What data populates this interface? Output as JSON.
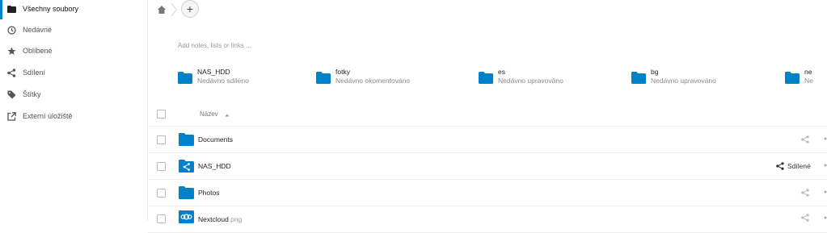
{
  "sidebar": {
    "items": [
      {
        "label": "Všechny soubory",
        "icon": "folder-icon",
        "active": true
      },
      {
        "label": "Nedávné",
        "icon": "clock-icon"
      },
      {
        "label": "Oblíbené",
        "icon": "star-icon"
      },
      {
        "label": "Sdílení",
        "icon": "share-icon"
      },
      {
        "label": "Štítky",
        "icon": "tag-icon"
      },
      {
        "label": "Externí úložiště",
        "icon": "external-icon"
      }
    ]
  },
  "notes": {
    "placeholder": "Add notes, lists or links ..."
  },
  "recommendations": [
    {
      "name": "NAS_HDD",
      "sub": "Nedávno sdíleno"
    },
    {
      "name": "fotky",
      "sub": "Nedávno okomentováno"
    },
    {
      "name": "es",
      "sub": "Nedávno upravováno"
    },
    {
      "name": "bg",
      "sub": "Nedávno upravováno"
    },
    {
      "name": "ne",
      "sub": "Ne"
    }
  ],
  "table": {
    "header_name": "Název",
    "rows": [
      {
        "name": "Documents",
        "ext": "",
        "type": "folder"
      },
      {
        "name": "NAS_HDD",
        "ext": "",
        "type": "shared-folder",
        "shared_label": "Sdílené"
      },
      {
        "name": "Photos",
        "ext": "",
        "type": "folder"
      },
      {
        "name": "Nextcloud",
        "ext": ".png",
        "type": "image"
      }
    ]
  },
  "colors": {
    "accent": "#0082c9",
    "folder": "#0082c9"
  }
}
